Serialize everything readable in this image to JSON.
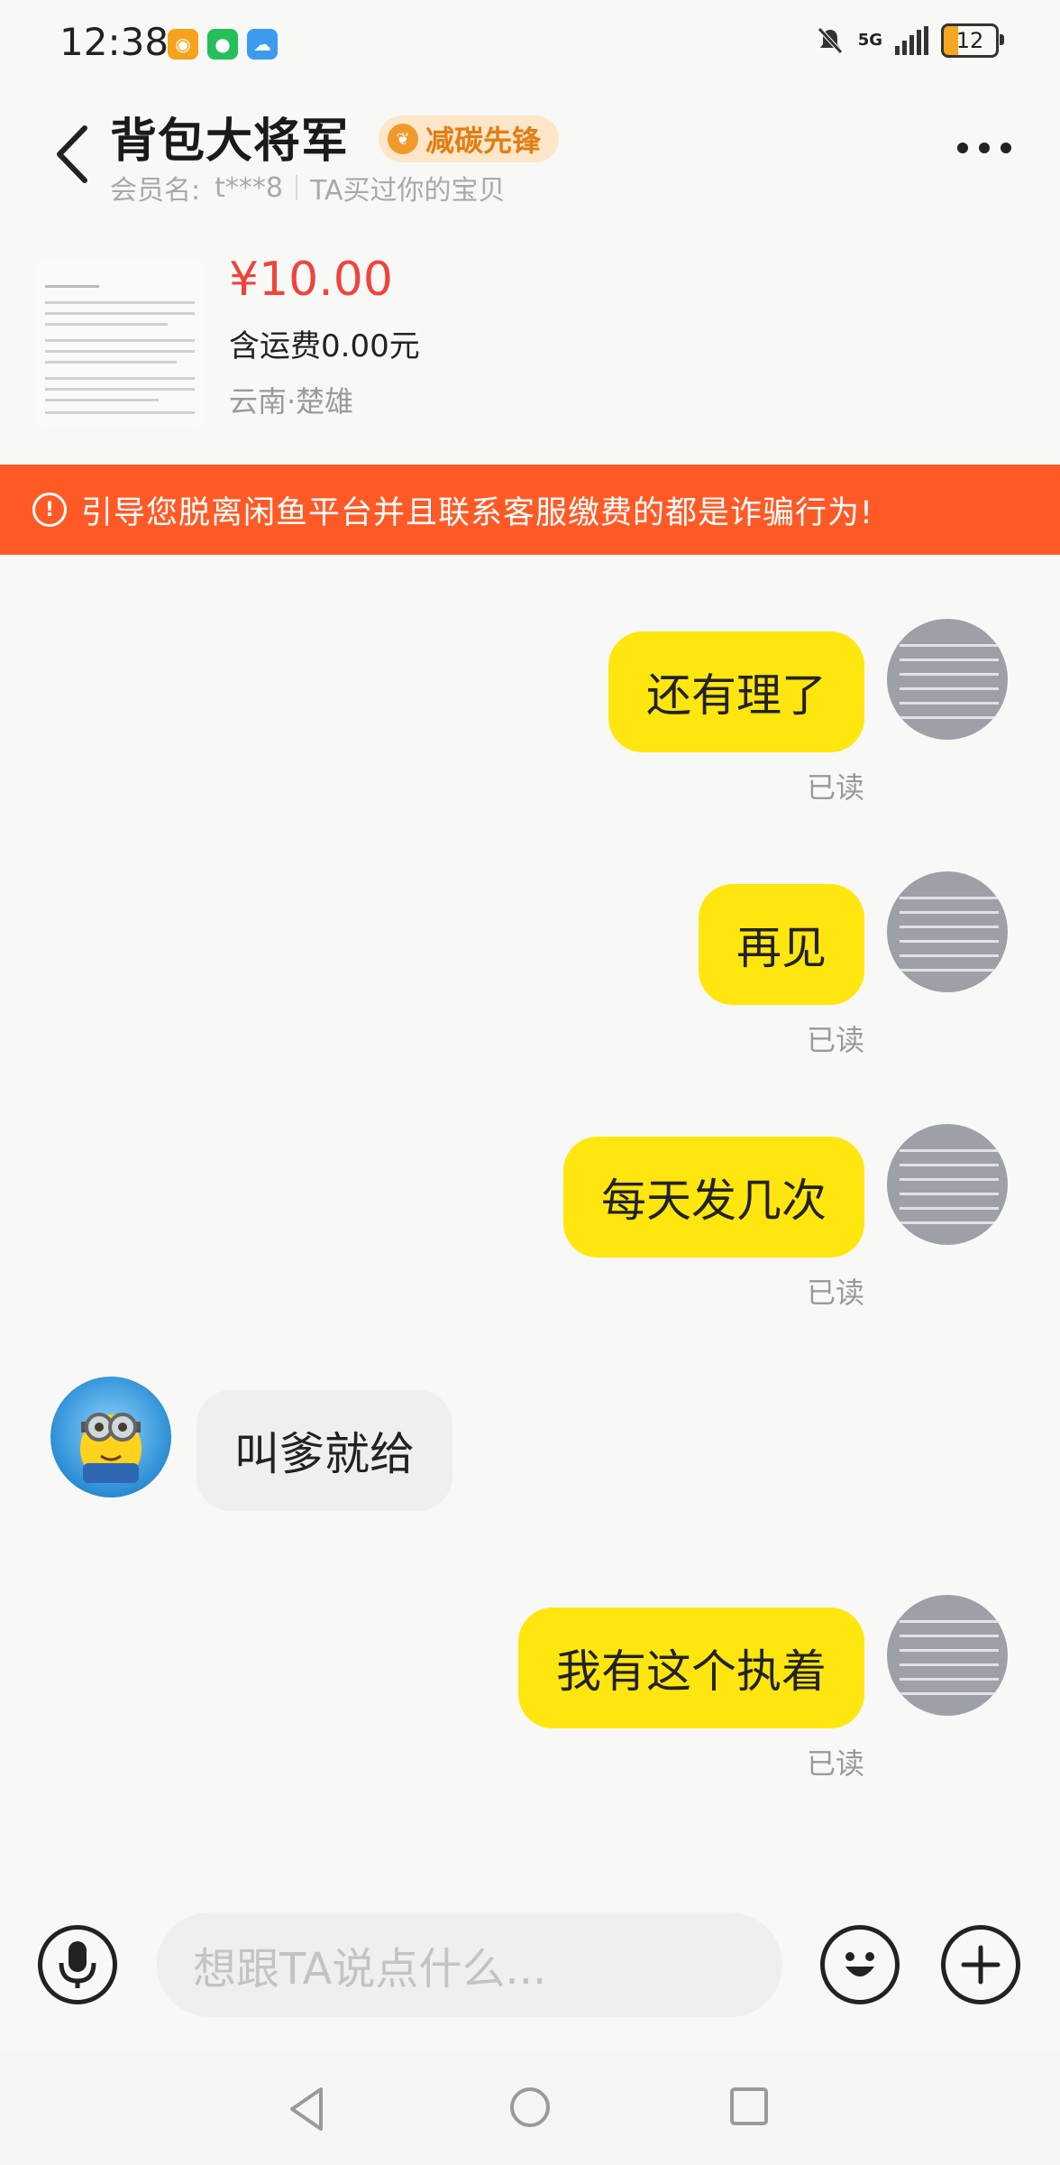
{
  "status_bar": {
    "time": "12:38",
    "network": "5G",
    "battery": "12",
    "apps": [
      {
        "name": "weibo-icon",
        "color": "#f6a21c"
      },
      {
        "name": "wechat-icon",
        "color": "#25c05b"
      },
      {
        "name": "weather-icon",
        "color": "#3c9bef"
      }
    ]
  },
  "header": {
    "seller_name": "背包大将军",
    "badge_label": "减碳先锋",
    "member_label": "会员名:",
    "member_id": "t***8",
    "purchase_note": "TA买过你的宝贝"
  },
  "product": {
    "price": "¥10.00",
    "shipping": "含运费0.00元",
    "location": "云南·楚雄"
  },
  "warning": {
    "text": "引导您脱离闲鱼平台并且联系客服缴费的都是诈骗行为!"
  },
  "messages": [
    {
      "side": "out",
      "text": "还有理了",
      "status": "已读"
    },
    {
      "side": "out",
      "text": "再见",
      "status": "已读"
    },
    {
      "side": "out",
      "text": "每天发几次",
      "status": "已读"
    },
    {
      "side": "in",
      "text": "叫爹就给"
    },
    {
      "side": "out",
      "text": "我有这个执着",
      "status": "已读"
    }
  ],
  "input_bar": {
    "placeholder": "想跟TA说点什么..."
  },
  "colors": {
    "accent_yellow": "#ffe60f",
    "price_red": "#f0433c",
    "warning_orange": "#ff5a26"
  }
}
